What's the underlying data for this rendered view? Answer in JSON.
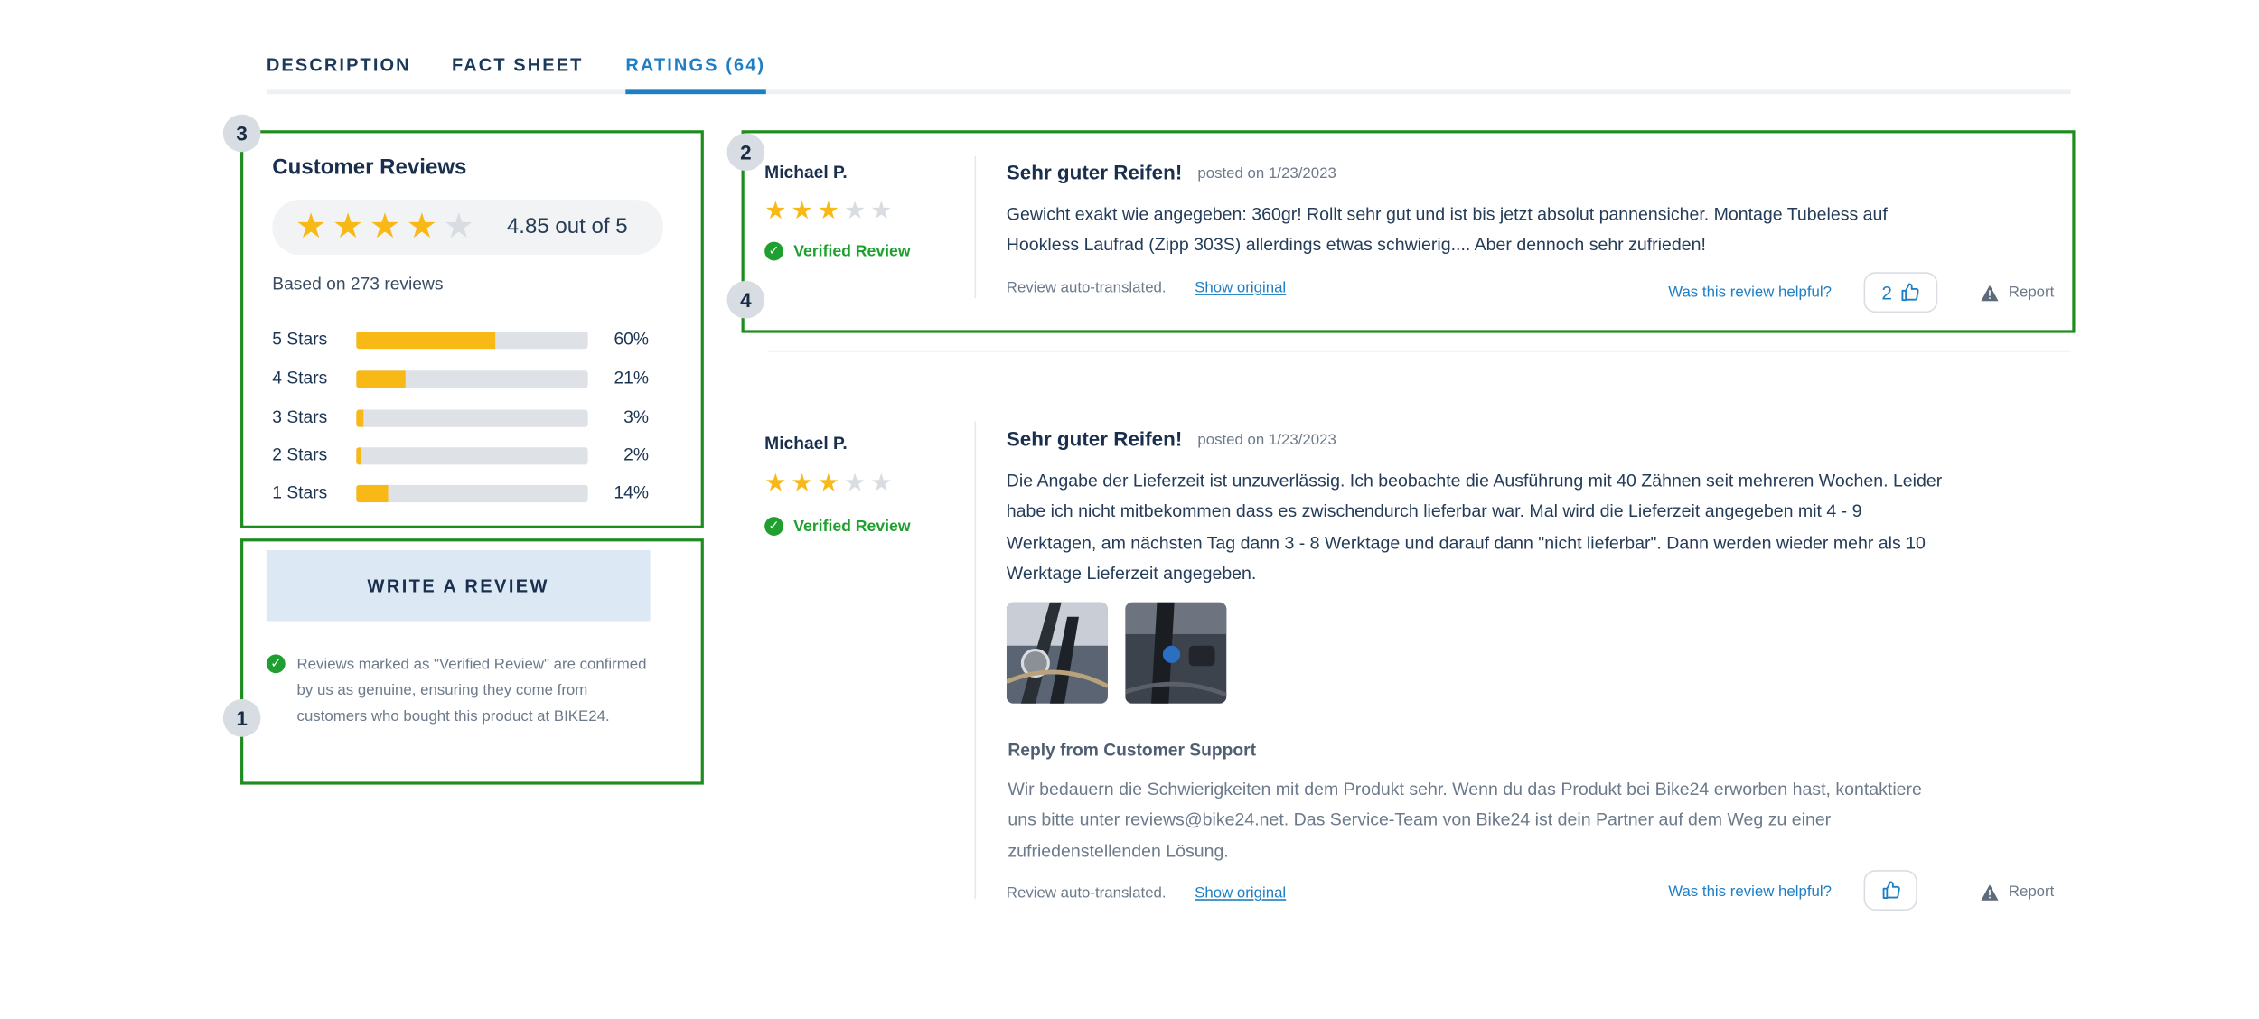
{
  "tabs": [
    {
      "label": "DESCRIPTION"
    },
    {
      "label": "FACT SHEET"
    },
    {
      "label": "RATINGS (64)"
    }
  ],
  "markers": [
    "1",
    "2",
    "3",
    "4"
  ],
  "summary": {
    "title": "Customer Reviews",
    "average_label": "4.85 out of 5",
    "average_stars_filled": 4,
    "based_on": "Based on 273 reviews",
    "distribution": [
      {
        "label": "5 Stars",
        "percent_label": "60%",
        "percent": 60
      },
      {
        "label": "4 Stars",
        "percent_label": "21%",
        "percent": 21
      },
      {
        "label": "3 Stars",
        "percent_label": "3%",
        "percent": 3
      },
      {
        "label": "2 Stars",
        "percent_label": "2%",
        "percent": 2
      },
      {
        "label": "1 Stars",
        "percent_label": "14%",
        "percent": 14
      }
    ]
  },
  "write_review": {
    "button_label": "WRITE A REVIEW",
    "verified_note": "Reviews marked as \"Verified Review\" are confirmed by us as genuine,  ensuring they come from customers who bought this product at BIKE24."
  },
  "reviews": [
    {
      "author": "Michael P.",
      "stars_filled": 3,
      "verified_label": "Verified Review",
      "title": "Sehr guter Reifen!",
      "posted": "posted on 1/23/2023",
      "body_lines": [
        "Gewicht exakt wie angegeben: 360gr! Rollt sehr gut und ist bis jetzt absolut pannensicher. Montage Tubeless auf",
        "Hookless Laufrad (Zipp 303S) allerdings etwas schwierig.... Aber dennoch sehr zufrieden!"
      ],
      "auto_translated": "Review auto-translated.",
      "show_original": "Show original",
      "helpful_question": "Was this review helpful?",
      "helpful_count": "2",
      "report_label": "Report"
    },
    {
      "author": "Michael P.",
      "stars_filled": 3,
      "verified_label": "Verified Review",
      "title": "Sehr guter Reifen!",
      "posted": "posted on 1/23/2023",
      "body_lines": [
        "Die Angabe der Lieferzeit ist unzuverlässig. Ich beobachte die Ausführung mit 40 Zähnen seit mehreren Wochen. Leider",
        "habe ich nicht mitbekommen dass es zwischendurch lieferbar war. Mal wird die Lieferzeit angegeben mit 4 - 9",
        "Werktagen, am nächsten Tag dann  3 - 8 Werktage und darauf dann \"nicht lieferbar\". Dann werden wieder mehr als 10",
        "Werktage Lieferzeit angegeben."
      ],
      "reply_title": "Reply from Customer Support",
      "reply_lines": [
        "Wir bedauern die Schwierigkeiten mit dem Produkt sehr. Wenn du das Produkt bei Bike24 erworben hast, kontaktiere",
        "uns bitte unter reviews@bike24.net. Das Service-Team von Bike24 ist dein Partner auf dem Weg zu einer",
        "zufriedenstellenden Lösung."
      ],
      "auto_translated": "Review auto-translated.",
      "show_original": "Show original",
      "helpful_question": "Was this review helpful?",
      "report_label": "Report"
    }
  ],
  "colors": {
    "accent": "#1e7fc4",
    "star": "#f8b916",
    "verified_green": "#1f9f2f",
    "highlight_box": "#1f8c1f"
  },
  "icons": [
    "star-icon",
    "check-circle-icon",
    "thumbs-up-icon",
    "warning-icon"
  ]
}
